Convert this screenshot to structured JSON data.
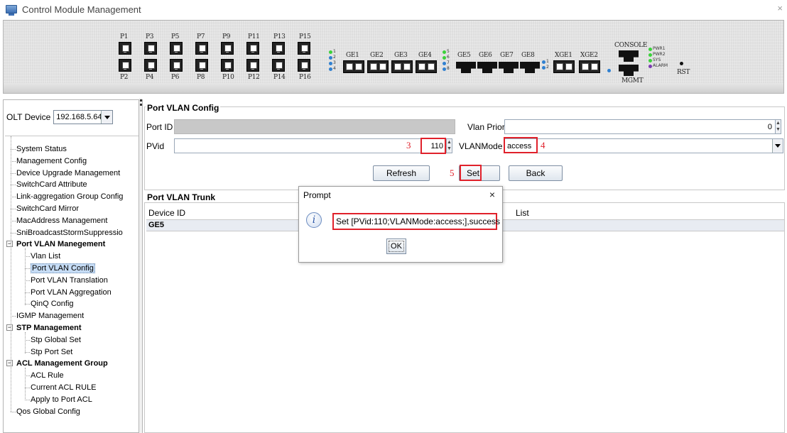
{
  "window": {
    "title": "Control Module Management",
    "close": "×"
  },
  "device_panel": {
    "top_port_labels": [
      "P1",
      "P3",
      "P5",
      "P7",
      "P9",
      "P11",
      "P13",
      "P15"
    ],
    "bottom_port_labels": [
      "P2",
      "P4",
      "P6",
      "P8",
      "P10",
      "P12",
      "P14",
      "P16"
    ],
    "ge_sfp_labels": [
      "GE1",
      "GE2",
      "GE3",
      "GE4"
    ],
    "ge_rj45_labels": [
      "GE5",
      "GE6",
      "GE7",
      "GE8"
    ],
    "xge_labels": [
      "XGE1",
      "XGE2"
    ],
    "console_label": "CONSOLE",
    "mgmt_label": "MGMT",
    "rst_label": "RST",
    "led_labels": [
      "PWR1",
      "PWR2",
      "SYS",
      "ALARM"
    ],
    "ge_led_nums_a": [
      "1",
      "2",
      "3",
      "4"
    ],
    "ge_led_nums_b": [
      "5",
      "6",
      "7",
      "8"
    ],
    "xge_led_nums": [
      "1",
      "2"
    ]
  },
  "left": {
    "olt_label": "OLT Device",
    "olt_value": "192.168.5.64 ...",
    "tree": [
      {
        "label": "System Status",
        "level": 1
      },
      {
        "label": "Management Config",
        "level": 1
      },
      {
        "label": "Device Upgrade Management",
        "level": 1
      },
      {
        "label": "SwitchCard Attribute",
        "level": 1
      },
      {
        "label": "Link-aggregation Group Config",
        "level": 1
      },
      {
        "label": "SwitchCard Mirror",
        "level": 1
      },
      {
        "label": "MacAddress Management",
        "level": 1
      },
      {
        "label": "SniBroadcastStormSuppressio",
        "level": 1
      },
      {
        "label": "Port VLAN Manegement",
        "level": 1,
        "group": true
      },
      {
        "label": "Vlan List",
        "level": 2
      },
      {
        "label": "Port VLAN Config",
        "level": 2,
        "selected": true
      },
      {
        "label": "Port VLAN Translation",
        "level": 2
      },
      {
        "label": "Port VLAN Aggregation",
        "level": 2
      },
      {
        "label": "QinQ Config",
        "level": 2
      },
      {
        "label": "IGMP Management",
        "level": 1
      },
      {
        "label": "STP Management",
        "level": 1,
        "group": true
      },
      {
        "label": "Stp Global Set",
        "level": 2
      },
      {
        "label": "Stp Port Set",
        "level": 2
      },
      {
        "label": "ACL Management Group",
        "level": 1,
        "group": true
      },
      {
        "label": "ACL Rule",
        "level": 2
      },
      {
        "label": "Current ACL RULE",
        "level": 2
      },
      {
        "label": "Apply to Port ACL",
        "level": 2
      },
      {
        "label": "Qos Global Config",
        "level": 1
      }
    ],
    "expander_symbol": "−"
  },
  "config": {
    "group_title": "Port VLAN Config",
    "port_id_label": "Port ID",
    "port_id_value": "",
    "vlan_priority_label": "Vlan Priority",
    "vlan_priority_value": "0",
    "pvid_label": "PVid",
    "pvid_value": "110",
    "vlanmode_label": "VLANMode",
    "vlanmode_value": "access",
    "annot_3": "3",
    "annot_4": "4",
    "annot_5": "5",
    "refresh_label": "Refresh",
    "set_label": "Set",
    "back_label": "Back"
  },
  "trunk": {
    "group_title": "Port VLAN Trunk",
    "col_device_id": "Device ID",
    "col_list_fragment": "List",
    "rows": [
      {
        "device_id": "GE5"
      }
    ]
  },
  "dialog": {
    "title": "Prompt",
    "close": "×",
    "message": "Set [PVid:110;VLANMode:access;],success",
    "ok_label": "OK"
  }
}
